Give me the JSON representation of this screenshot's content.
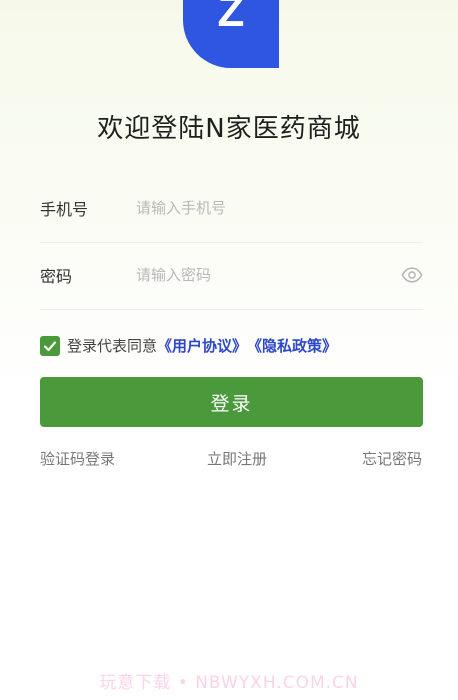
{
  "app": {
    "title": "欢迎登陆N家医药商城",
    "logo_letter": "Z",
    "logo_color": "#2f56e0"
  },
  "form": {
    "phone_label": "手机号",
    "phone_placeholder": "请输入手机号",
    "password_label": "密码",
    "password_placeholder": "请输入密码"
  },
  "agreement": {
    "checked": true,
    "text": "登录代表同意",
    "user_agreement": "《用户协议》",
    "privacy_policy": "《隐私政策》"
  },
  "actions": {
    "login_label": "登录",
    "code_login": "验证码登录",
    "register": "立即注册",
    "forgot_password": "忘记密码"
  },
  "colors": {
    "primary_green": "#4a9a3c",
    "link_blue": "#2d48c8"
  },
  "icons": {
    "password_toggle": "eye-icon",
    "checkbox_mark": "checkmark-icon"
  },
  "watermark": "玩意下载 • NBWYXH.COM.CN"
}
